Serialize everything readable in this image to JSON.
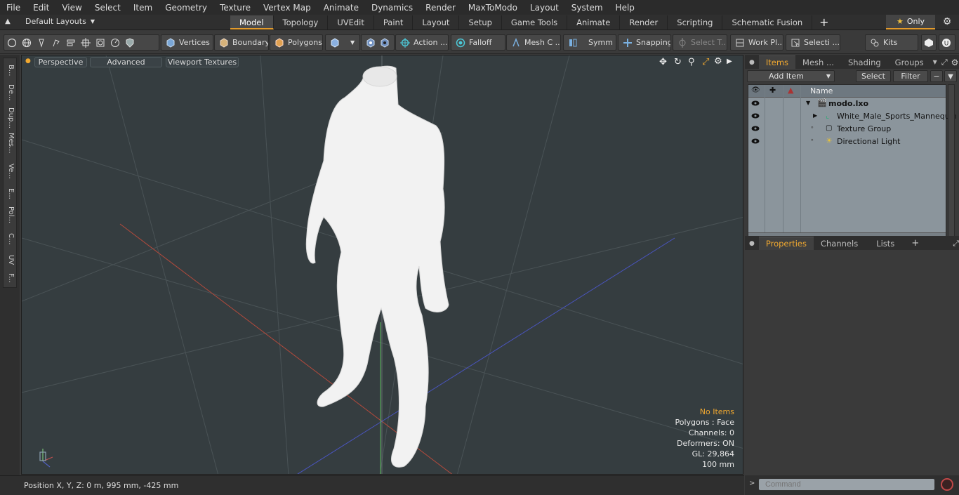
{
  "menu": [
    "File",
    "Edit",
    "View",
    "Select",
    "Item",
    "Geometry",
    "Texture",
    "Vertex Map",
    "Animate",
    "Dynamics",
    "Render",
    "MaxToModo",
    "Layout",
    "System",
    "Help"
  ],
  "layout_dropdown": "Default Layouts",
  "mode_tabs": [
    "Model",
    "Topology",
    "UVEdit",
    "Paint",
    "Layout",
    "Setup",
    "Game Tools",
    "Animate",
    "Render",
    "Scripting",
    "Schematic Fusion"
  ],
  "active_tab": "Model",
  "only_label": "Only",
  "toolbar": {
    "vertices": "Vertices",
    "boundary": "Boundary",
    "polygons": "Polygons",
    "action": "Action ...",
    "falloff": "Falloff",
    "mesh": "Mesh C ...",
    "symm": "Symm ...",
    "snapping": "Snapping",
    "select_t": "Select T...",
    "work_pl": "Work Pl...",
    "selecti": "Selecti ...",
    "kits": "Kits"
  },
  "left_tabs": [
    "B...",
    "De...",
    "Dup...",
    "Mes...",
    "Ve...",
    "E...",
    "Pol...",
    "C...",
    "UV",
    "F..."
  ],
  "viewport": {
    "perspective": "Perspective",
    "advanced": "Advanced",
    "viewport_textures": "Viewport Textures",
    "stats": {
      "items": "No Items",
      "polygons": "Polygons : Face",
      "channels": "Channels: 0",
      "deformers": "Deformers: ON",
      "gl": "GL: 29,864",
      "scale": "100 mm"
    }
  },
  "status": {
    "position": "Position X, Y, Z:   0 m, 995 mm, -425 mm"
  },
  "items_panel": {
    "tabs": [
      "Items",
      "Mesh ...",
      "Shading",
      "Groups"
    ],
    "add_item": "Add Item",
    "select": "Select",
    "filter": "Filter",
    "name_header": "Name",
    "rows": [
      {
        "label": "modo.lxo"
      },
      {
        "label": "White_Male_Sports_Mannequin"
      },
      {
        "label": "Texture Group"
      },
      {
        "label": "Directional Light"
      }
    ]
  },
  "props_panel": {
    "tabs": [
      "Properties",
      "Channels",
      "Lists"
    ]
  },
  "command": {
    "placeholder": "Command"
  },
  "colors": {
    "accent": "#e39b2c",
    "viewport_bg": "#353d40",
    "list_bg": "#8b959c"
  }
}
